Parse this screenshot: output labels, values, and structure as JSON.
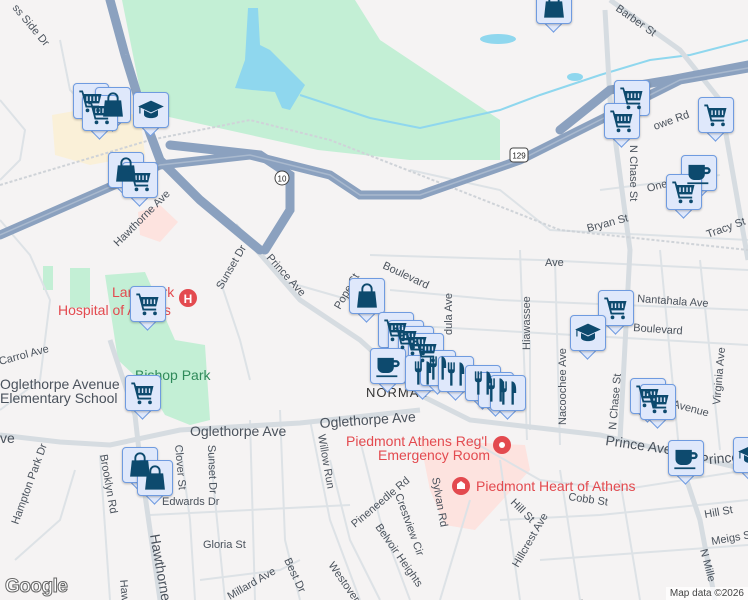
{
  "map": {
    "attribution": "Map data ©2026",
    "logo": "Google",
    "colors": {
      "park": "#c3efd5",
      "water": "#8fd7ee",
      "highway": "#8ba1bf",
      "road": "#d6dce1",
      "hospital": "#fde3df",
      "marker_bg": "#dfe8fb",
      "marker_icon": "#0d4a6e",
      "poi_red": "#e34a4f"
    },
    "shields": {
      "hwy10": "10",
      "us129": "129"
    },
    "street_labels": {
      "cross_side": "ss Side Dr",
      "barber": "Barber St",
      "hawthorne_n": "Hawthorne Ave",
      "prince_nw": "Prince Ave",
      "sunset_n": "Sunset Dr",
      "boulevard_w": "Boulevard",
      "porter": "Pope St",
      "ave_top": "Ave",
      "nantahala": "Nantahala Ave",
      "boulevard_e": "Boulevard",
      "hiawassee": "Hiawassee",
      "nacoochee": "Nacoochee Ave",
      "chase_n": "N Chase St",
      "chase_s": "N Chase St",
      "virginia": "Virginia Ave",
      "avenue_e": "Avenue",
      "prince_e": "Prince Ave",
      "prince_e2": "Prince A",
      "oglethorpe_w": "Oglethorpe Ave",
      "oglethorpe_e": "Oglethorpe Ave",
      "ave_w": "ve",
      "carrol": "Carrol Ave",
      "brooklyn": "Brooklyn Rd",
      "hampton": "Hampton Park Dr",
      "clover": "Clover St",
      "sunset_s": "Sunset Dr",
      "edwards": "Edwards Dr",
      "gloria": "Gloria St",
      "hawthorne_s": "Hawthorne",
      "haw_s2": "Haw",
      "millard": "Millard Ave",
      "best": "Best Dr",
      "westover": "Westover",
      "willow": "Willow Run",
      "pineneedle": "Pineneedle Rd",
      "crestview": "Crestview Cir",
      "sylvan": "Sylvan Rd",
      "belvoir": "Belvoir Heights",
      "hill_w": "Hill St",
      "hillcrest": "Hillcrest Ave",
      "cobb": "Cobb St",
      "hill_e": "Hill St",
      "meigs": "Meigs St",
      "millege": "N Mille",
      "lowe": "owe Rd",
      "oneta": "One",
      "bryan": "Bryan St",
      "tracy": "Tracy St",
      "normal": "NORMAL",
      "dula": "dula Ave",
      "n_p": "N P"
    },
    "poi_labels": {
      "hospital_l1": "Landmark",
      "hospital_l2": "Hospital of Athens",
      "bishop_park": "Bishop Park",
      "school_l1": "Oglethorpe Avenue",
      "school_l2": "Elementary School",
      "piedmont_er_l1": "Piedmont Athens Reg'l",
      "piedmont_er_l2": "Emergency Room",
      "piedmont_heart": "Piedmont Heart of Athens"
    },
    "markers": [
      {
        "type": "cart"
      },
      {
        "type": "bag"
      },
      {
        "type": "cart"
      },
      {
        "type": "school"
      },
      {
        "type": "bag"
      },
      {
        "type": "cart"
      },
      {
        "type": "cart"
      },
      {
        "type": "cart"
      },
      {
        "type": "bag"
      },
      {
        "type": "bag"
      },
      {
        "type": "bag"
      },
      {
        "type": "cart"
      },
      {
        "type": "cart"
      },
      {
        "type": "cart"
      },
      {
        "type": "cart"
      },
      {
        "type": "cup"
      },
      {
        "type": "restaurant"
      },
      {
        "type": "restaurant"
      },
      {
        "type": "restaurant"
      },
      {
        "type": "restaurant"
      },
      {
        "type": "restaurant"
      },
      {
        "type": "restaurant"
      },
      {
        "type": "cart"
      },
      {
        "type": "school"
      },
      {
        "type": "cart"
      },
      {
        "type": "cart"
      },
      {
        "type": "cup"
      },
      {
        "type": "school"
      },
      {
        "type": "bag"
      },
      {
        "type": "cart"
      },
      {
        "type": "cart"
      },
      {
        "type": "cart"
      },
      {
        "type": "cup"
      },
      {
        "type": "cart"
      }
    ]
  }
}
